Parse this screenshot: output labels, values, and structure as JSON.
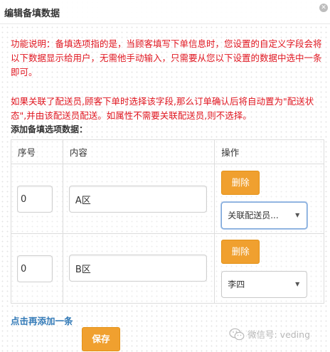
{
  "header": {
    "title": "编辑备填数据",
    "close_icon": "close-icon"
  },
  "notices": {
    "line1": "功能说明：备填选项指的是，当顾客填写下单信息时，您设置的自定义字段会将以下数据显示给用户，无需他手动输入，只需要从您以下设置的数据中选中一条即可。",
    "line2": "如果关联了配送员,顾客下单时选择该字段,那么订单确认后将自动置为\"配送状态\",并由该配送员配送。如属性不需要关联配送员,则不选择。"
  },
  "section_label": "添加备填选项数据：",
  "table": {
    "headers": {
      "no": "序号",
      "content": "内容",
      "op": "操作"
    },
    "rows": [
      {
        "no": "0",
        "content": "A区",
        "delete_label": "删除",
        "courier": "关联配送员..."
      },
      {
        "no": "0",
        "content": "B区",
        "delete_label": "删除",
        "courier": "李四"
      }
    ]
  },
  "add_link": "点击再添加一条",
  "save_label": "保存",
  "watermark": "微信号: veding",
  "colors": {
    "notice_red": "#e0151f",
    "accent_orange": "#f0a02f",
    "link_blue": "#337ab7"
  }
}
